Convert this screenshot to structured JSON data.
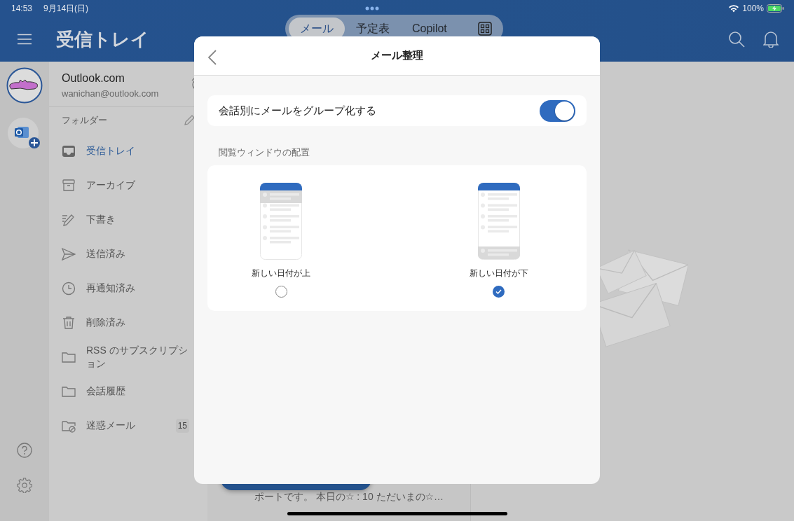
{
  "status_bar": {
    "time": "14:53",
    "date": "9月14日(日)",
    "battery": "100%"
  },
  "header": {
    "title": "受信トレイ",
    "tabs": [
      {
        "label": "メール",
        "selected": true
      },
      {
        "label": "予定表",
        "selected": false
      },
      {
        "label": "Copilot",
        "selected": false
      }
    ]
  },
  "account": {
    "name": "Outlook.com",
    "email": "wanichan@outlook.com"
  },
  "folders": {
    "heading": "フォルダー",
    "items": [
      {
        "label": "受信トレイ",
        "kind": "inbox",
        "selected": true
      },
      {
        "label": "アーカイブ",
        "kind": "archive",
        "selected": false
      },
      {
        "label": "下書き",
        "kind": "drafts",
        "selected": false
      },
      {
        "label": "送信済み",
        "kind": "sent",
        "selected": false
      },
      {
        "label": "再通知済み",
        "kind": "snoozed",
        "selected": false
      },
      {
        "label": "削除済み",
        "kind": "deleted",
        "selected": false
      },
      {
        "label": "RSS のサブスクリプション",
        "kind": "folder",
        "selected": false
      },
      {
        "label": "会話履歴",
        "kind": "folder",
        "selected": false
      },
      {
        "label": "迷惑メール",
        "kind": "junk",
        "selected": false,
        "count": "15"
      }
    ]
  },
  "message_preview": {
    "snippet": "ポートです。 本日の☆ : 10 ただいまの☆…"
  },
  "dialog": {
    "title": "メール整理",
    "settings": [
      {
        "label": "会話別にメールをグループ化する",
        "on": true
      }
    ],
    "section_heading": "閲覧ウィンドウの配置",
    "layout_options": [
      {
        "label": "新しい日付が上",
        "kind": "newest-top",
        "selected": false
      },
      {
        "label": "新しい日付が下",
        "kind": "newest-bottom",
        "selected": true
      }
    ]
  }
}
